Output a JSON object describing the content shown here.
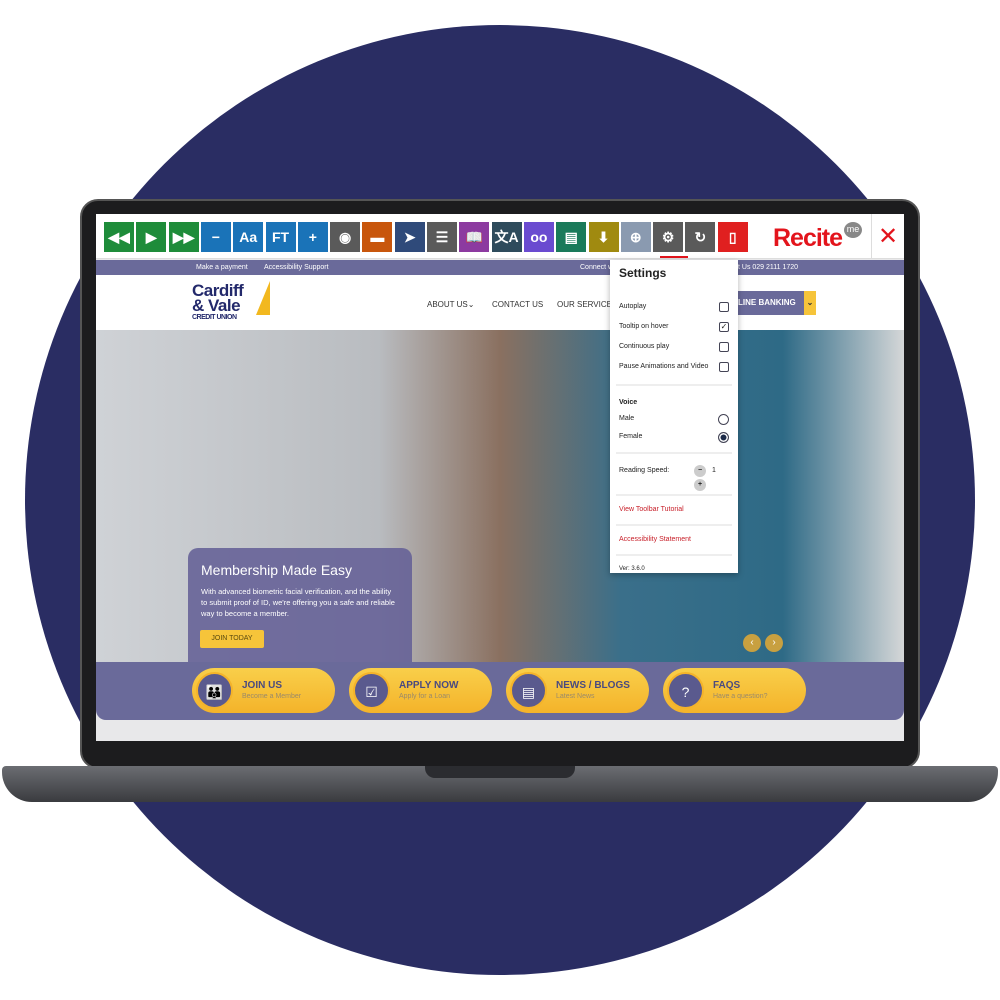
{
  "toolbar": {
    "buttons": [
      {
        "icon": "rewind-icon",
        "glyph": "◀◀",
        "color": "#1e8c3a"
      },
      {
        "icon": "play-icon",
        "glyph": "▶",
        "color": "#1e8c3a"
      },
      {
        "icon": "fast-forward-icon",
        "glyph": "▶▶",
        "color": "#1e8c3a"
      },
      {
        "icon": "decrease-text-icon",
        "glyph": "−",
        "color": "#1a73b8"
      },
      {
        "icon": "font-icon",
        "glyph": "Aa",
        "color": "#1a73b8"
      },
      {
        "icon": "font-type-icon",
        "glyph": "FT",
        "color": "#1a73b8"
      },
      {
        "icon": "increase-text-icon",
        "glyph": "+",
        "color": "#1a73b8"
      },
      {
        "icon": "color-wheel-icon",
        "glyph": "◉",
        "color": "#5a5a5a"
      },
      {
        "icon": "ruler-icon",
        "glyph": "▬",
        "color": "#c8560c"
      },
      {
        "icon": "pointer-icon",
        "glyph": "➤",
        "color": "#2f4a7a"
      },
      {
        "icon": "screen-mask-icon",
        "glyph": "☰",
        "color": "#5a5a5a"
      },
      {
        "icon": "dictionary-icon",
        "glyph": "📖",
        "color": "#8c3aa0"
      },
      {
        "icon": "translate-icon",
        "glyph": "文A",
        "color": "#2e4b5c"
      },
      {
        "icon": "glasses-icon",
        "glyph": "oo",
        "color": "#6a4bd0"
      },
      {
        "icon": "text-only-icon",
        "glyph": "▤",
        "color": "#1a7a5a"
      },
      {
        "icon": "download-icon",
        "glyph": "⬇",
        "color": "#a08a10"
      },
      {
        "icon": "magnifier-icon",
        "glyph": "⊕",
        "color": "#8a9ab0"
      },
      {
        "icon": "settings-gear-icon",
        "glyph": "⚙",
        "color": "#5a5a5a"
      },
      {
        "icon": "reset-icon",
        "glyph": "↻",
        "color": "#5a5a5a"
      },
      {
        "icon": "pdf-icon",
        "glyph": "▯",
        "color": "#e02020"
      }
    ],
    "brand": "Recite",
    "brand_badge": "me",
    "close": "✕"
  },
  "topbar": {
    "links": [
      "Make a payment",
      "Accessibility Support"
    ],
    "connect": "Connect w",
    "contact": "t Us  029 2111 1720"
  },
  "header": {
    "logo_line1": "Cardiff",
    "logo_line2": "& Vale",
    "logo_line3": "CREDIT UNION",
    "nav": [
      "ABOUT US⌄",
      "CONTACT US",
      "OUR SERVICES"
    ],
    "online_banking": "LINE BANKING",
    "dropdown": "⌄"
  },
  "hero": {
    "title": "Membership Made Easy",
    "text": "With advanced biometric facial verification, and the ability to submit proof of ID, we're offering you a safe and reliable way to become a member.",
    "cta": "JOIN TODAY",
    "prev": "‹",
    "next": "›"
  },
  "quicklinks": [
    {
      "title": "JOIN US",
      "sub": "Become a Member",
      "glyph": "👪"
    },
    {
      "title": "APPLY NOW",
      "sub": "Apply for a Loan",
      "glyph": "☑"
    },
    {
      "title": "NEWS / BLOGS",
      "sub": "Latest News",
      "glyph": "▤"
    },
    {
      "title": "FAQS",
      "sub": "Have a question?",
      "glyph": "?"
    }
  ],
  "settings": {
    "title": "Settings",
    "options": [
      {
        "label": "Autoplay",
        "checked": false,
        "mark": ""
      },
      {
        "label": "Tooltip on hover",
        "checked": true,
        "mark": "✓"
      },
      {
        "label": "Continuous play",
        "checked": false,
        "mark": ""
      },
      {
        "label": "Pause Animations and Video",
        "checked": false,
        "mark": ""
      }
    ],
    "voice_label": "Voice",
    "voices": [
      {
        "label": "Male",
        "selected": false
      },
      {
        "label": "Female",
        "selected": true
      }
    ],
    "speed_label": "Reading Speed:",
    "speed_value": "1",
    "minus": "−",
    "plus": "+",
    "tutorial": "View Toolbar Tutorial",
    "statement": "Accessibility Statement",
    "version": "Ver: 3.6.0"
  }
}
